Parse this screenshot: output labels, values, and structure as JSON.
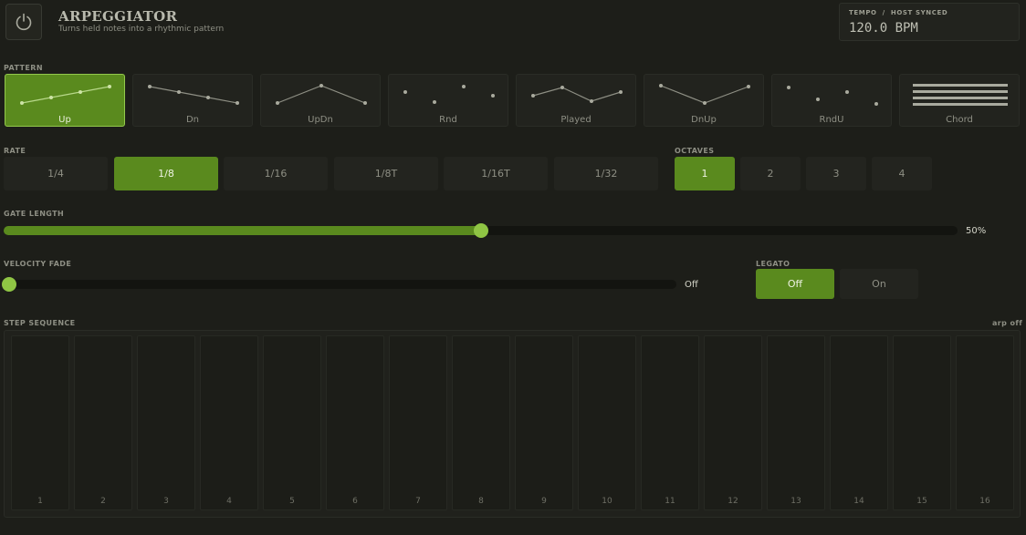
{
  "header": {
    "title": "ARPEGGIATOR",
    "subtitle": "Turns held notes into a rhythmic pattern",
    "tempo_label": "TEMPO  /  HOST SYNCED",
    "tempo_value": "120.0 BPM"
  },
  "pattern": {
    "label": "PATTERN",
    "selected": "Up",
    "items": [
      {
        "label": "Up",
        "icon": "ascending-line-icon",
        "active": true
      },
      {
        "label": "Dn",
        "icon": "descending-line-icon",
        "active": false
      },
      {
        "label": "UpDn",
        "icon": "up-down-line-icon",
        "active": false
      },
      {
        "label": "Rnd",
        "icon": "random-dots-icon",
        "active": false
      },
      {
        "label": "Played",
        "icon": "zigzag-line-icon",
        "active": false
      },
      {
        "label": "DnUp",
        "icon": "down-up-line-icon",
        "active": false
      },
      {
        "label": "RndU",
        "icon": "random-unique-dots-icon",
        "active": false
      },
      {
        "label": "Chord",
        "icon": "chord-bars-icon",
        "active": false
      }
    ]
  },
  "rate": {
    "label": "RATE",
    "selected": "1/8",
    "options": [
      "1/4",
      "1/8",
      "1/16",
      "1/8T",
      "1/16T",
      "1/32"
    ]
  },
  "octaves": {
    "label": "OCTAVES",
    "selected": "1",
    "options": [
      "1",
      "2",
      "3",
      "4"
    ]
  },
  "gate": {
    "label": "GATE LENGTH",
    "percent": 50,
    "value_text": "50%"
  },
  "velocity": {
    "label": "VELOCITY FADE",
    "percent": 0,
    "value_text": "Off"
  },
  "legato": {
    "label": "LEGATO",
    "selected": "Off",
    "options": [
      "Off",
      "On"
    ]
  },
  "steps": {
    "label": "STEP SEQUENCE",
    "status": "arp off",
    "numbers": [
      "1",
      "2",
      "3",
      "4",
      "5",
      "6",
      "7",
      "8",
      "9",
      "10",
      "11",
      "12",
      "13",
      "14",
      "15",
      "16"
    ]
  },
  "colors": {
    "accent": "#5a8a1e",
    "accent_light": "#8fc544",
    "background": "#1d1e19"
  }
}
